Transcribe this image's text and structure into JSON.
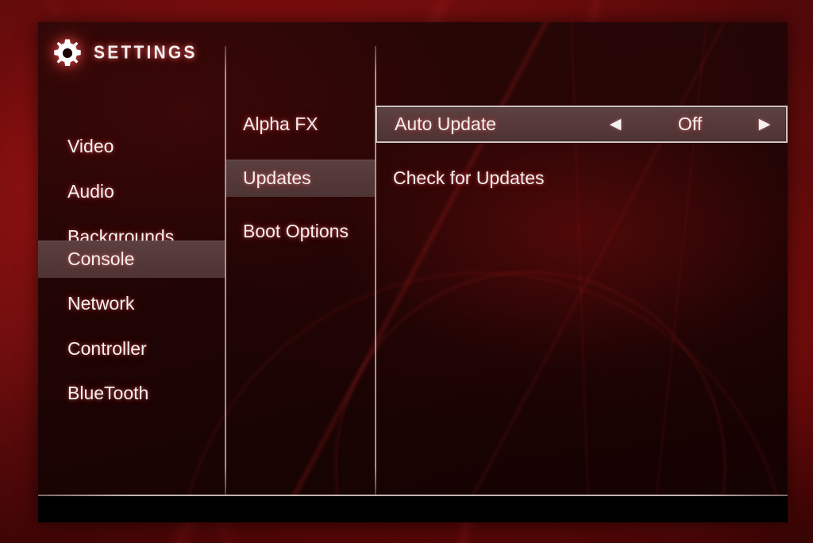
{
  "header": {
    "title": "SETTINGS",
    "icon": "gear-icon"
  },
  "sidebar": {
    "items": [
      {
        "label": "Video",
        "selected": false
      },
      {
        "label": "Audio",
        "selected": false
      },
      {
        "label": "Backgrounds",
        "selected": false
      },
      {
        "label": "Console",
        "selected": true
      },
      {
        "label": "Network",
        "selected": false
      },
      {
        "label": "Controller",
        "selected": false
      },
      {
        "label": "BlueTooth",
        "selected": false
      }
    ]
  },
  "subnav": {
    "items": [
      {
        "label": "Alpha FX",
        "selected": false
      },
      {
        "label": "Updates",
        "selected": true
      },
      {
        "label": "Boot Options",
        "selected": false
      }
    ]
  },
  "detail": {
    "rows": [
      {
        "label": "Auto Update",
        "type": "stepper",
        "value": "Off",
        "left_arrow": "◀",
        "right_arrow": "▶",
        "selected": true
      },
      {
        "label": "Check for Updates",
        "type": "action",
        "selected": false
      }
    ]
  },
  "colors": {
    "panel_background": "#1c0404",
    "backdrop_red": "#8d1111",
    "highlight": "#55393a",
    "selection_border": "#cfc3bf",
    "text": "#f4f0f0",
    "footer": "#000000"
  }
}
